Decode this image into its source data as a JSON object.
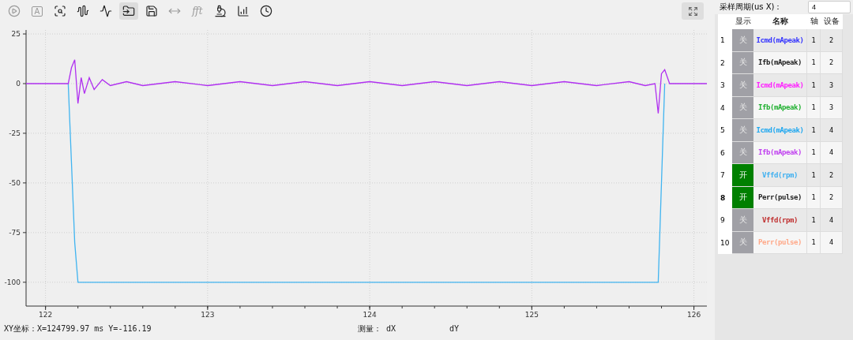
{
  "toolbar": [
    {
      "kind": "play",
      "disabled": true,
      "selected": false
    },
    {
      "kind": "letter",
      "label": "A",
      "disabled": true,
      "selected": false
    },
    {
      "kind": "zoom",
      "disabled": false,
      "selected": false
    },
    {
      "kind": "wave",
      "disabled": false,
      "selected": false
    },
    {
      "kind": "wave-cross",
      "disabled": false,
      "selected": false
    },
    {
      "kind": "folder",
      "disabled": false,
      "selected": true
    },
    {
      "kind": "save",
      "disabled": false,
      "selected": false
    },
    {
      "kind": "fit",
      "disabled": true,
      "selected": false
    },
    {
      "kind": "letter",
      "label": "fft",
      "disabled": true,
      "selected": false
    },
    {
      "kind": "probe",
      "disabled": false,
      "selected": false
    },
    {
      "kind": "chart",
      "disabled": false,
      "selected": false
    },
    {
      "kind": "clock",
      "disabled": false,
      "selected": false
    }
  ],
  "chart": {
    "chart_data": {
      "type": "line",
      "x": [
        121.88,
        122.0,
        122.1,
        122.14,
        122.16,
        122.18,
        122.2,
        122.22,
        122.24,
        122.27,
        122.3,
        122.35,
        122.4,
        122.5,
        122.6,
        122.8,
        123.0,
        123.2,
        123.4,
        123.6,
        123.8,
        124.0,
        124.2,
        124.4,
        124.6,
        124.8,
        125.0,
        125.2,
        125.4,
        125.6,
        125.7,
        125.76,
        125.78,
        125.8,
        125.82,
        125.85,
        125.9,
        126.08
      ],
      "series": [
        {
          "color": "#40b4f0",
          "values": [
            null,
            null,
            null,
            0,
            -40,
            -80,
            -100,
            -100,
            -100,
            -100,
            -100,
            -100,
            -100,
            -100,
            -100,
            -100,
            -100,
            -100,
            -100,
            -100,
            -100,
            -100,
            -100,
            -100,
            -100,
            -100,
            -100,
            -100,
            -100,
            -100,
            -100,
            -100,
            -100,
            -50,
            0,
            null,
            null,
            null
          ]
        },
        {
          "color": "#b030f0",
          "values": [
            0,
            0,
            0,
            0,
            8,
            12,
            -10,
            3,
            -5,
            3,
            -3,
            2,
            -1,
            1,
            -1,
            1,
            -1,
            1,
            -1,
            1,
            -1,
            1,
            -1,
            1,
            -1,
            1,
            -1,
            1,
            -1,
            1,
            -1,
            0,
            -15,
            5,
            7,
            0,
            0,
            0
          ]
        }
      ],
      "grid": true,
      "xlim": [
        121.88,
        126.08
      ],
      "ylim": [
        -112,
        27
      ],
      "xticks": [
        {
          "value": 122,
          "label": "122"
        },
        {
          "value": 123,
          "label": "123"
        },
        {
          "value": 124,
          "label": "124"
        },
        {
          "value": 125,
          "label": "125"
        },
        {
          "value": 126,
          "label": "126"
        }
      ],
      "yticks": [
        {
          "value": 25,
          "label": "25"
        },
        {
          "value": 0,
          "label": "0"
        },
        {
          "value": -25,
          "label": "-25"
        },
        {
          "value": -50,
          "label": "-50"
        },
        {
          "value": -75,
          "label": "-75"
        },
        {
          "value": -100,
          "label": "-100"
        }
      ]
    }
  },
  "status_bar": {
    "coordinates": "XY坐标：X=124799.97 ms  Y=-116.19",
    "measure_label": "测量：",
    "dx": "dX",
    "dy": "dY"
  },
  "sample_period": {
    "label": "采样周期(us X)：",
    "value": "4"
  },
  "table": {
    "columns": [
      "",
      "显示",
      "名称",
      "轴",
      "设备"
    ],
    "rows": [
      {
        "index": "1",
        "display": "关",
        "on": false,
        "name": "Icmd(mApeak)",
        "color": "#3333ff",
        "axis": "1",
        "device": "2",
        "selected": false
      },
      {
        "index": "2",
        "display": "关",
        "on": false,
        "name": "Ifb(mApeak)",
        "color": "#222222",
        "axis": "1",
        "device": "2",
        "selected": false
      },
      {
        "index": "3",
        "display": "关",
        "on": false,
        "name": "Icmd(mApeak)",
        "color": "#ff20ff",
        "axis": "1",
        "device": "3",
        "selected": false
      },
      {
        "index": "4",
        "display": "关",
        "on": false,
        "name": "Ifb(mApeak)",
        "color": "#20b030",
        "axis": "1",
        "device": "3",
        "selected": false
      },
      {
        "index": "5",
        "display": "关",
        "on": false,
        "name": "Icmd(mApeak)",
        "color": "#20a8f0",
        "axis": "1",
        "device": "4",
        "selected": false
      },
      {
        "index": "6",
        "display": "关",
        "on": false,
        "name": "Ifb(mApeak)",
        "color": "#c040f0",
        "axis": "1",
        "device": "4",
        "selected": false
      },
      {
        "index": "7",
        "display": "开",
        "on": true,
        "name": "Vffd(rpm)",
        "color": "#40b0f0",
        "axis": "1",
        "device": "2",
        "selected": false
      },
      {
        "index": "8",
        "display": "开",
        "on": true,
        "name": "Perr(pulse)",
        "color": "#222222",
        "axis": "1",
        "device": "2",
        "selected": true
      },
      {
        "index": "9",
        "display": "关",
        "on": false,
        "name": "Vffd(rpm)",
        "color": "#c03030",
        "axis": "1",
        "device": "4",
        "selected": false
      },
      {
        "index": "10",
        "display": "关",
        "on": false,
        "name": "Perr(pulse)",
        "color": "#ffa888",
        "axis": "1",
        "device": "4",
        "selected": false
      }
    ]
  }
}
